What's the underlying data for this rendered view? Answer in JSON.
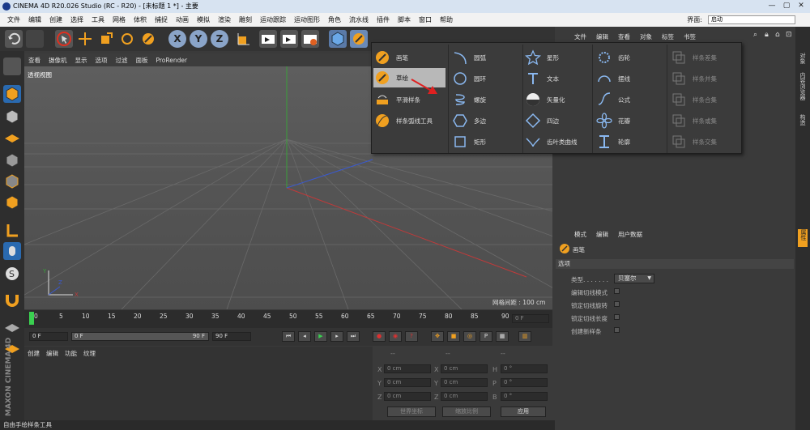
{
  "window": {
    "title": "CINEMA 4D R20.026 Studio (RC - R20) - [未标题 1 *] - 主要",
    "min": "—",
    "max": "▢",
    "close": "✕"
  },
  "menu": {
    "items": [
      "文件",
      "编辑",
      "创建",
      "选择",
      "工具",
      "网格",
      "体积",
      "捕捉",
      "动画",
      "模拟",
      "渲染",
      "雕刻",
      "运动跟踪",
      "运动图形",
      "角色",
      "流水线",
      "插件",
      "脚本",
      "窗口",
      "帮助"
    ],
    "layout_label": "界面:",
    "layout_value": "启动"
  },
  "toolbar": {
    "x_label": "X",
    "y_label": "Y",
    "z_label": "Z"
  },
  "viewport": {
    "menu": [
      "查看",
      "摄像机",
      "显示",
      "选项",
      "过滤",
      "面板",
      "ProRender"
    ],
    "label": "透视视图",
    "grid_spacing": "网格间距 : 100 cm",
    "axis_x": "X",
    "axis_y": "Y",
    "axis_z": "Z"
  },
  "timeline": {
    "ticks": [
      "0",
      "5",
      "10",
      "15",
      "20",
      "25",
      "30",
      "35",
      "40",
      "45",
      "50",
      "55",
      "60",
      "65",
      "70",
      "75",
      "80",
      "85",
      "90"
    ],
    "current_frame": "0 F"
  },
  "controls": {
    "start": "0 F",
    "range_start": "0 F",
    "range_end": "90 F",
    "end": "90 F"
  },
  "material": {
    "menu": [
      "创建",
      "编辑",
      "功能",
      "纹理"
    ]
  },
  "coords": {
    "headers": [
      "--",
      "--",
      "--"
    ],
    "rows": [
      {
        "a": "X",
        "av": "0 cm",
        "b": "X",
        "bv": "0 cm",
        "c": "H",
        "cv": "0 °"
      },
      {
        "a": "Y",
        "av": "0 cm",
        "b": "Y",
        "bv": "0 cm",
        "c": "P",
        "cv": "0 °"
      },
      {
        "a": "Z",
        "av": "0 cm",
        "b": "Z",
        "bv": "0 cm",
        "c": "B",
        "cv": "0 °"
      }
    ],
    "world": "世界坐标",
    "scale": "缩放比例",
    "apply": "应用"
  },
  "objects": {
    "tabs": [
      "文件",
      "编辑",
      "查看",
      "对象",
      "标签",
      "书签"
    ]
  },
  "attributes": {
    "tabs": [
      "模式",
      "编辑",
      "用户数据"
    ],
    "object_name": "画笔",
    "section": "选项",
    "type_label": "类型. . . . . . .",
    "type_value": "贝塞尔",
    "opts": [
      "编辑切线模式",
      "锁定切线旋转",
      "锁定切线长度",
      "创建新样条"
    ]
  },
  "right_strip": [
    "对象",
    "内容浏览器",
    "构造",
    "属性"
  ],
  "popup": {
    "col1": [
      "画笔",
      "草绘",
      "平滑样条",
      "样条弧线工具"
    ],
    "col2": [
      "圆弧",
      "圆环",
      "螺旋",
      "多边",
      "矩形"
    ],
    "col3": [
      "星形",
      "文本",
      "矢量化",
      "四边",
      "齿叶类曲线"
    ],
    "col4": [
      "齿轮",
      "摆线",
      "公式",
      "花瓣",
      "轮廓"
    ],
    "col5": [
      "样条差集",
      "样条并集",
      "样条合集",
      "样条或集",
      "样条交集"
    ]
  },
  "status": "自由手绘样条工具",
  "colors": {
    "accent": "#f0a020",
    "selected_bg": "#b8b8b8",
    "popup_bg": "#3b3b3b",
    "x_axis": "#c03a3a",
    "y_axis": "#3aa03a",
    "z_axis": "#3a5ad0"
  }
}
